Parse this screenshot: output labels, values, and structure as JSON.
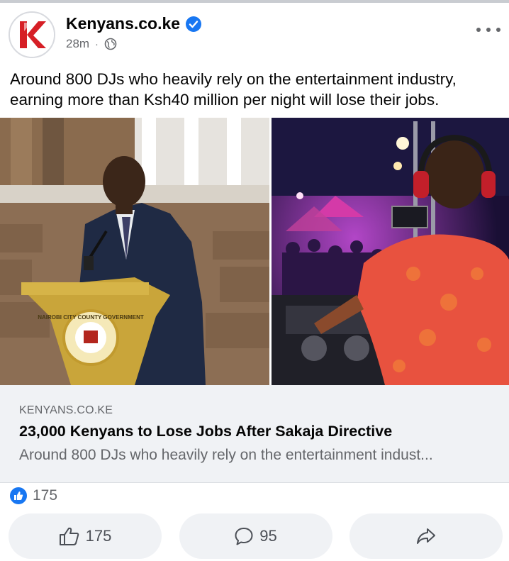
{
  "page": {
    "name": "Kenyans.co.ke",
    "logo_letter": "K",
    "timestamp": "28m",
    "separator": "·",
    "audience_icon": "globe-icon",
    "verified_icon": "verified-badge-icon"
  },
  "post": {
    "text": "Around 800 DJs who heavily rely on the entertainment industry, earning more than Ksh40 million per night will lose their jobs."
  },
  "images": {
    "podium_seal_text": "NAIROBI CITY COUNTY GOVERNMENT"
  },
  "link_card": {
    "domain": "KENYANS.CO.KE",
    "title": "23,000 Kenyans to Lose Jobs After Sakaja Directive",
    "description": "Around 800 DJs who heavily rely on the entertainment indust..."
  },
  "reactions": {
    "icon": "like-icon",
    "count": "175"
  },
  "actions": {
    "like": {
      "icon": "thumbs-up-icon",
      "count": "175"
    },
    "comment": {
      "icon": "comment-icon",
      "count": "95"
    },
    "share": {
      "icon": "share-icon"
    }
  },
  "colors": {
    "brand_red": "#d61f26",
    "facebook_blue": "#1877f2",
    "muted_text": "#65676b",
    "card_bg": "#f0f2f5"
  }
}
